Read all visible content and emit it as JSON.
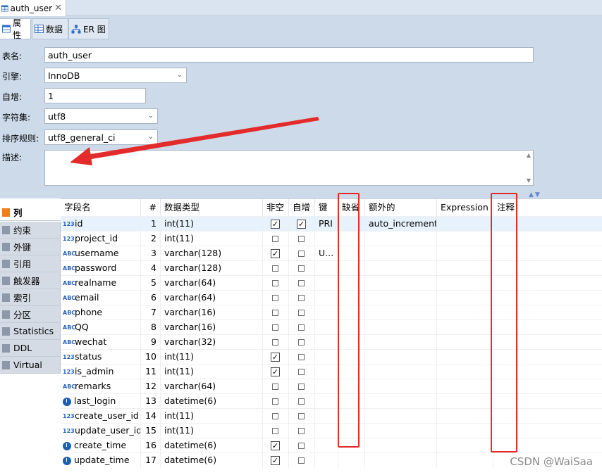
{
  "editor_tab": {
    "title": "auth_user",
    "close": "✕"
  },
  "subtabs": {
    "properties": "属性",
    "data": "数据",
    "er": "ER 图"
  },
  "form": {
    "table_name_label": "表名:",
    "table_name": "auth_user",
    "engine_label": "引擎:",
    "engine": "InnoDB",
    "auto_inc_label": "自增:",
    "auto_inc": "1",
    "charset_label": "字符集:",
    "charset": "utf8",
    "collation_label": "排序规则:",
    "collation": "utf8_general_ci",
    "description_label": "描述:",
    "description": ""
  },
  "sidebar": {
    "items": [
      {
        "label": "列",
        "icon": "columns-icon"
      },
      {
        "label": "约束",
        "icon": "constraint-icon"
      },
      {
        "label": "外键",
        "icon": "foreign-key-icon"
      },
      {
        "label": "引用",
        "icon": "reference-icon"
      },
      {
        "label": "触发器",
        "icon": "trigger-icon"
      },
      {
        "label": "索引",
        "icon": "index-icon"
      },
      {
        "label": "分区",
        "icon": "partition-icon"
      },
      {
        "label": "Statistics",
        "icon": "statistics-icon"
      },
      {
        "label": "DDL",
        "icon": "ddl-icon"
      },
      {
        "label": "Virtual",
        "icon": "virtual-icon"
      }
    ]
  },
  "grid": {
    "headers": [
      "字段名",
      "#",
      "数据类型",
      "非空",
      "自增",
      "键",
      "缺省",
      "额外的",
      "Expression",
      "注释"
    ],
    "rows": [
      {
        "name": "id",
        "type_icon": "123",
        "pos": "1",
        "dtype": "int(11)",
        "notnull": true,
        "autoinc": true,
        "key": "PRI",
        "extra": "auto_increment"
      },
      {
        "name": "project_id",
        "type_icon": "123",
        "pos": "2",
        "dtype": "int(11)",
        "notnull": false,
        "autoinc": false,
        "key": "",
        "extra": ""
      },
      {
        "name": "username",
        "type_icon": "ABC",
        "pos": "3",
        "dtype": "varchar(128)",
        "notnull": true,
        "autoinc": false,
        "key": "U...",
        "extra": ""
      },
      {
        "name": "password",
        "type_icon": "ABC",
        "pos": "4",
        "dtype": "varchar(128)",
        "notnull": false,
        "autoinc": false,
        "key": "",
        "extra": ""
      },
      {
        "name": "realname",
        "type_icon": "ABC",
        "pos": "5",
        "dtype": "varchar(64)",
        "notnull": false,
        "autoinc": false,
        "key": "",
        "extra": ""
      },
      {
        "name": "email",
        "type_icon": "ABC",
        "pos": "6",
        "dtype": "varchar(64)",
        "notnull": false,
        "autoinc": false,
        "key": "",
        "extra": ""
      },
      {
        "name": "phone",
        "type_icon": "ABC",
        "pos": "7",
        "dtype": "varchar(16)",
        "notnull": false,
        "autoinc": false,
        "key": "",
        "extra": ""
      },
      {
        "name": "QQ",
        "type_icon": "ABC",
        "pos": "8",
        "dtype": "varchar(16)",
        "notnull": false,
        "autoinc": false,
        "key": "",
        "extra": ""
      },
      {
        "name": "wechat",
        "type_icon": "ABC",
        "pos": "9",
        "dtype": "varchar(32)",
        "notnull": false,
        "autoinc": false,
        "key": "",
        "extra": ""
      },
      {
        "name": "status",
        "type_icon": "123",
        "pos": "10",
        "dtype": "int(11)",
        "notnull": true,
        "autoinc": false,
        "key": "",
        "extra": ""
      },
      {
        "name": "is_admin",
        "type_icon": "123",
        "pos": "11",
        "dtype": "int(11)",
        "notnull": true,
        "autoinc": false,
        "key": "",
        "extra": ""
      },
      {
        "name": "remarks",
        "type_icon": "ABC",
        "pos": "12",
        "dtype": "varchar(64)",
        "notnull": false,
        "autoinc": false,
        "key": "",
        "extra": ""
      },
      {
        "name": "last_login",
        "type_icon": "clock",
        "pos": "13",
        "dtype": "datetime(6)",
        "notnull": false,
        "autoinc": false,
        "key": "",
        "extra": ""
      },
      {
        "name": "create_user_id",
        "type_icon": "123",
        "pos": "14",
        "dtype": "int(11)",
        "notnull": false,
        "autoinc": false,
        "key": "",
        "extra": ""
      },
      {
        "name": "update_user_id",
        "type_icon": "123",
        "pos": "15",
        "dtype": "int(11)",
        "notnull": false,
        "autoinc": false,
        "key": "",
        "extra": ""
      },
      {
        "name": "create_time",
        "type_icon": "clock",
        "pos": "16",
        "dtype": "datetime(6)",
        "notnull": true,
        "autoinc": false,
        "key": "",
        "extra": ""
      },
      {
        "name": "update_time",
        "type_icon": "clock",
        "pos": "17",
        "dtype": "datetime(6)",
        "notnull": true,
        "autoinc": false,
        "key": "",
        "extra": ""
      }
    ]
  },
  "annotation_color": "#e42b2b",
  "watermark": "CSDN @WaiSaa"
}
